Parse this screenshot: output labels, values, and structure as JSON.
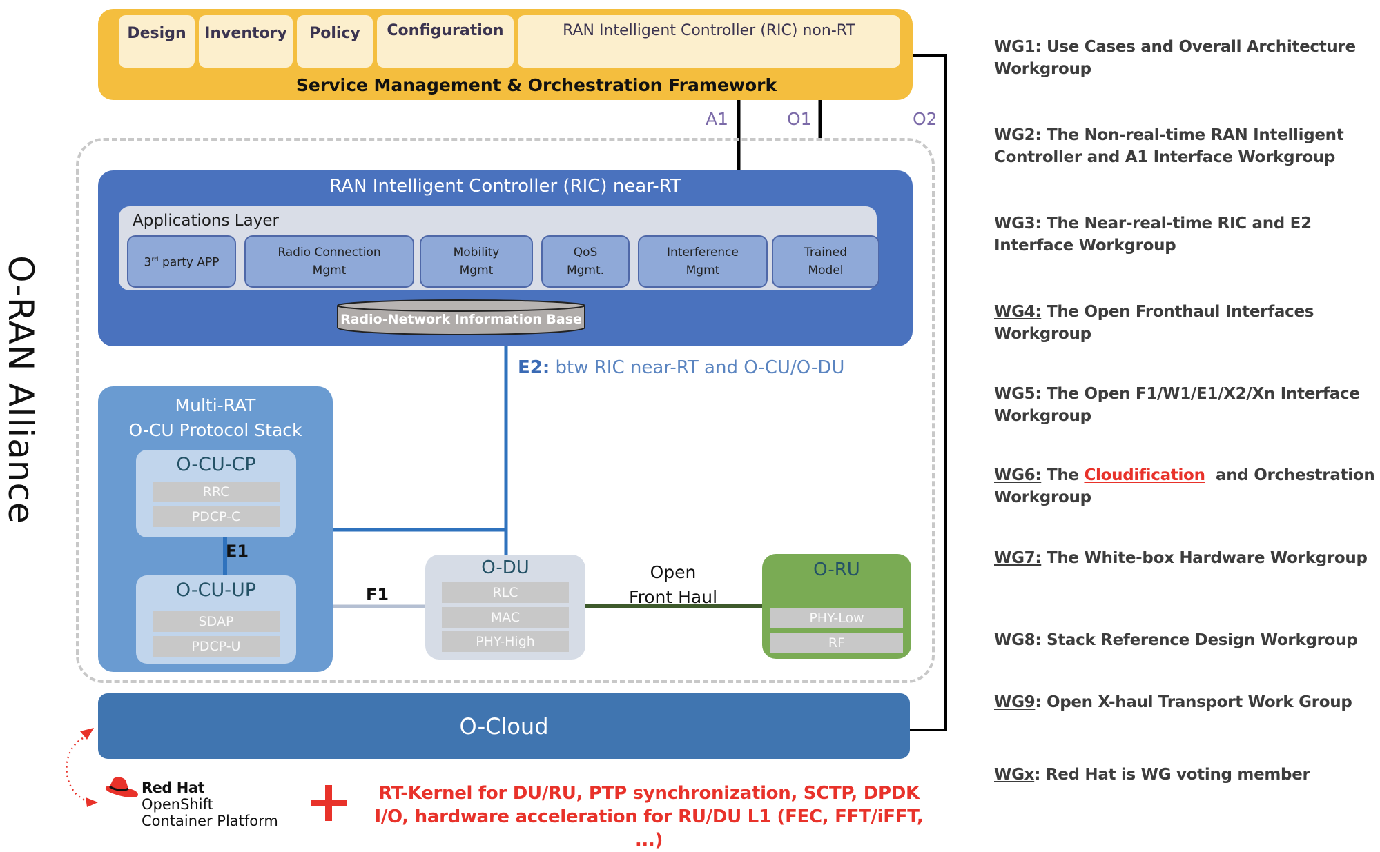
{
  "side_label": "O-RAN Alliance",
  "smo": {
    "title": "Service Management & Orchestration Framework",
    "boxes": [
      "Design",
      "Inventory",
      "Policy",
      "Configuration",
      "RAN Intelligent Controller (RIC) non-RT"
    ]
  },
  "interfaces": {
    "a1": "A1",
    "o1": "O1",
    "o2": "O2"
  },
  "ric_near_rt": {
    "title": "RAN Intelligent Controller (RIC) near-RT",
    "apps_layer_title": "Applications Layer",
    "apps": [
      {
        "line1": "3rd party APP",
        "line2": ""
      },
      {
        "line1": "Radio Connection",
        "line2": "Mgmt"
      },
      {
        "line1": "Mobility",
        "line2": "Mgmt"
      },
      {
        "line1": "QoS",
        "line2": "Mgmt."
      },
      {
        "line1": "Interference",
        "line2": "Mgmt"
      },
      {
        "line1": "Trained",
        "line2": "Model"
      }
    ],
    "rnib": "Radio-Network Information Base"
  },
  "e2": {
    "code": "E2:",
    "desc": " btw RIC near-RT and O-CU/O-DU"
  },
  "ocu": {
    "title_line1": "Multi-RAT",
    "title_line2": "O-CU Protocol Stack",
    "cp": {
      "title": "O-CU-CP",
      "layers": [
        "RRC",
        "PDCP-C"
      ]
    },
    "e1": "E1",
    "up": {
      "title": "O-CU-UP",
      "layers": [
        "SDAP",
        "PDCP-U"
      ]
    }
  },
  "f1": "F1",
  "odu": {
    "title": "O-DU",
    "layers": [
      "RLC",
      "MAC",
      "PHY-High"
    ]
  },
  "open_fronthaul": {
    "line1": "Open",
    "line2": "Front Haul"
  },
  "oru": {
    "title": "O-RU",
    "layers": [
      "PHY-Low",
      "RF"
    ]
  },
  "ocloud": "O-Cloud",
  "redhat": {
    "brand": "Red Hat",
    "product": "OpenShift",
    "platform": "Container Platform"
  },
  "rt_features": {
    "line1": "RT-Kernel for DU/RU, PTP synchronization, SCTP, DPDK",
    "line2": "I/O, hardware acceleration for RU/DU L1 (FEC, FFT/iFFT, ...)"
  },
  "workgroups": [
    {
      "code": "WG1",
      "underline": false,
      "sep": ": ",
      "text": "Use Cases and Overall Architecture Workgroup"
    },
    {
      "code": "WG2",
      "underline": false,
      "sep": ": ",
      "text": "The Non-real-time RAN Intelligent Controller and A1 Interface Workgroup"
    },
    {
      "code": "WG3",
      "underline": false,
      "sep": ": ",
      "text": "The Near-real-time RIC and E2 Interface Workgroup"
    },
    {
      "code": "WG4:",
      "underline": true,
      "sep": " ",
      "text": "The Open Fronthaul Interfaces Workgroup"
    },
    {
      "code": "WG5",
      "underline": false,
      "sep": ": ",
      "text": "The Open F1/W1/E1/X2/Xn Interface Workgroup"
    },
    {
      "code": "WG6:",
      "underline": true,
      "sep": " ",
      "pre": "The ",
      "highlight": "Cloudification",
      "text": "  and Orchestration Workgroup"
    },
    {
      "code": "WG7:",
      "underline": true,
      "sep": " ",
      "text": "The White-box Hardware Workgroup"
    },
    {
      "code": "WG8",
      "underline": false,
      "sep": ": ",
      "text": "Stack Reference Design Workgroup"
    },
    {
      "code": "WG9",
      "underline": true,
      "sep": ": ",
      "text": "Open X-haul Transport Work Group"
    },
    {
      "code": "WGx",
      "underline": true,
      "sep": ": ",
      "text": "Red Hat is WG voting member"
    }
  ],
  "colors": {
    "smo": "#f4be3e",
    "ric_near_rt": "#4a72be",
    "ocu": "#6a9bd1",
    "oru": "#7aab54",
    "ocloud": "#4075b0",
    "accent_red": "#e8322a"
  }
}
